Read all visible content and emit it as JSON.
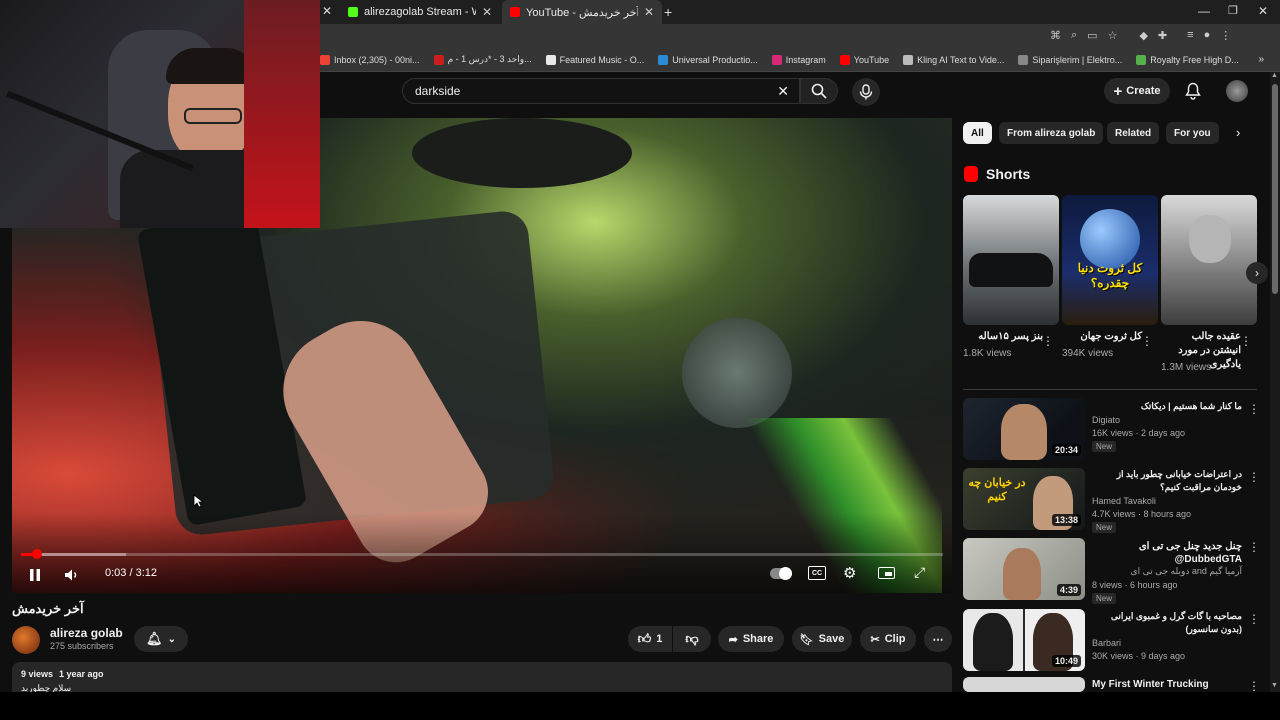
{
  "browser": {
    "tabs": [
      {
        "title": "alirezagolab Stream - Watch Li..."
      },
      {
        "title": "YouTube - آخر خریدمش",
        "active": true
      }
    ],
    "bookmarks": [
      {
        "label": "Inbox (2,305) - 00ni...",
        "color": "#ea4335"
      },
      {
        "label": "واحد 3 - *درس 1 - م...",
        "color": "#c81e1e"
      },
      {
        "label": "Featured Music - O...",
        "color": "#e8e8e8"
      },
      {
        "label": "Universal Productio...",
        "color": "#2a8ad4"
      },
      {
        "label": "Instagram",
        "color": "#d62976"
      },
      {
        "label": "YouTube",
        "color": "#ff0000"
      },
      {
        "label": "Kling AI Text to Vide...",
        "color": "#bbbbbb"
      },
      {
        "label": "Siparişlerim | Elektro...",
        "color": "#888888"
      },
      {
        "label": "Royalty Free High D...",
        "color": "#55b04a"
      }
    ]
  },
  "header": {
    "search_value": "darkside",
    "create_label": "Create"
  },
  "player": {
    "time": "0:03 / 3:12",
    "progress_fraction": 0.017
  },
  "video": {
    "title": "آخر خریدمش",
    "channel": "alireza golab",
    "subscribers": "275 subscribers",
    "likes": "1",
    "share_label": "Share",
    "save_label": "Save",
    "clip_label": "Clip",
    "views": "9 views",
    "age": "1 year ago",
    "description": "سلام چطورید"
  },
  "sidebar": {
    "chips": [
      "All",
      "From alireza golab",
      "Related",
      "For you"
    ],
    "shorts_heading": "Shorts",
    "shorts": [
      {
        "title": "بنز پسر ۱۵ساله",
        "views": "1.8K views"
      },
      {
        "title": "کل ثروت جهان",
        "views": "394K views"
      },
      {
        "title": "عقیده جالب انیشتن در مورد یادگیری",
        "views": "1.3M views"
      }
    ],
    "videos": [
      {
        "title": "ما کنار شما هستیم | دیکاتک",
        "channel": "Digiato",
        "meta": "16K views · 2 days ago",
        "badge": "New",
        "duration": "20:34"
      },
      {
        "title": "در اعتراضات خیابانی چطور باید از خودمان مراقبت کنیم؟",
        "channel": "Hamed Tavakoli",
        "meta": "4.7K views · 8 hours ago",
        "badge": "New",
        "duration": "13:38"
      },
      {
        "title": "چنل جدید چنل جی تی ای DubbedGTA@",
        "channel": "آرمیا گیم and دوبله جی تی ای",
        "meta": "8 views · 6 hours ago",
        "badge": "New",
        "duration": "4:39"
      },
      {
        "title": "مصاحبه با گات گرل و غمبوی ایرانی (بدون سانسور)",
        "channel": "Barbari",
        "meta": "30K views · 9 days ago",
        "badge": "",
        "duration": "10:49"
      },
      {
        "title": "My First Winter Trucking",
        "channel": "",
        "meta": "",
        "badge": "",
        "duration": ""
      }
    ]
  },
  "overlay": {
    "thumb1_text": "کل ثروت دنیا چقدره؟",
    "thumb2_text": "در خیابان چه کنیم"
  },
  "colors": {
    "accent": "#ff0000",
    "bg": "#0f0f0f",
    "surface": "#272727"
  }
}
